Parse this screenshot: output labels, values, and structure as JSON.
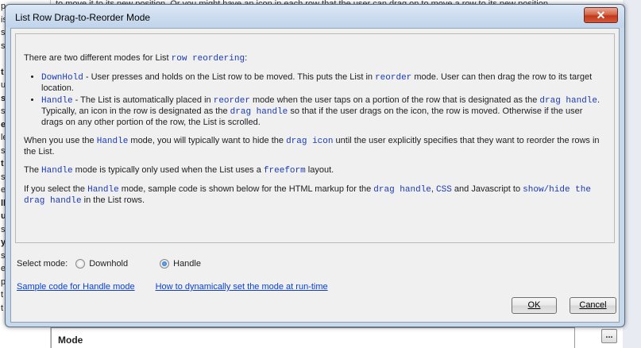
{
  "background": {
    "left_snippets": [
      "p",
      "is",
      "s",
      "s",
      "",
      "t",
      "ua",
      "st",
      "s",
      "er",
      "le",
      "s",
      "t",
      "s",
      "e",
      "ll",
      "ult",
      "s",
      "yo",
      "s",
      "ef",
      "pl",
      "t it",
      "t item hove"
    ],
    "top_text": "to move it to its new position. Or you might have an icon in each row that the user can drag on to move a row to its new position.",
    "bottom_header": "Mode",
    "bottom_button": "..."
  },
  "dialog": {
    "title": "List Row Drag-to-Reorder Mode",
    "close_glyph": "✕"
  },
  "content": {
    "intro_text": "There are two different modes for List ",
    "intro_code": "row reordering",
    "intro_end": ":",
    "b1_code": "DownHold",
    "b1_text1": " - User presses and holds on the List row to be moved. This puts the List in ",
    "b1_code2": "reorder",
    "b1_text2": " mode. User can then drag the row to its target location.",
    "b2_code": "Handle",
    "b2_text1": " - The List is automatically placed in ",
    "b2_code2": "reorder",
    "b2_text2": " mode when the user taps on a portion of the row that is designated as the ",
    "b2_code3": "drag handle",
    "b2_text3": ". Typically, an icon in the row is designated as the ",
    "b2_code4": "drag handle",
    "b2_text4": " so that if the user drags on the icon, the row is moved. Otherwise if the user drags on any other portion of the row, the List is scrolled.",
    "p2_text1": "When you use the ",
    "p2_code1": "Handle",
    "p2_text2": " mode, you will typically want to hide the ",
    "p2_code2": "drag icon",
    "p2_text3": " until the user explicitly specifies that they want to reorder the rows in the List.",
    "p3_text1": "The ",
    "p3_code1": "Handle",
    "p3_text2": " mode is typically only used when the List uses a ",
    "p3_code2": "freeform",
    "p3_text3": " layout.",
    "p4_text1": "If you select the ",
    "p4_code1": "Handle",
    "p4_text2": " mode, sample code is shown below for the HTML markup for the ",
    "p4_code2": "drag handle",
    "p4_text3": ", ",
    "p4_code3": "CSS",
    "p4_text4": " and Javascript to ",
    "p4_code4": "show/hide the drag handle",
    "p4_text5": " in the List rows."
  },
  "select_mode": {
    "label": "Select mode:",
    "options": [
      "Downhold",
      "Handle"
    ],
    "selected": "Handle"
  },
  "links": {
    "sample_code": "Sample code for Handle mode",
    "dynamic_mode": "How to dynamically set the mode at run-time"
  },
  "buttons": {
    "ok": "OK",
    "cancel": "Cancel"
  },
  "colors": {
    "code": "#1a3ab8",
    "link": "#0a3fd1",
    "close": "#c0391b",
    "frame": "#c9d9ec"
  }
}
